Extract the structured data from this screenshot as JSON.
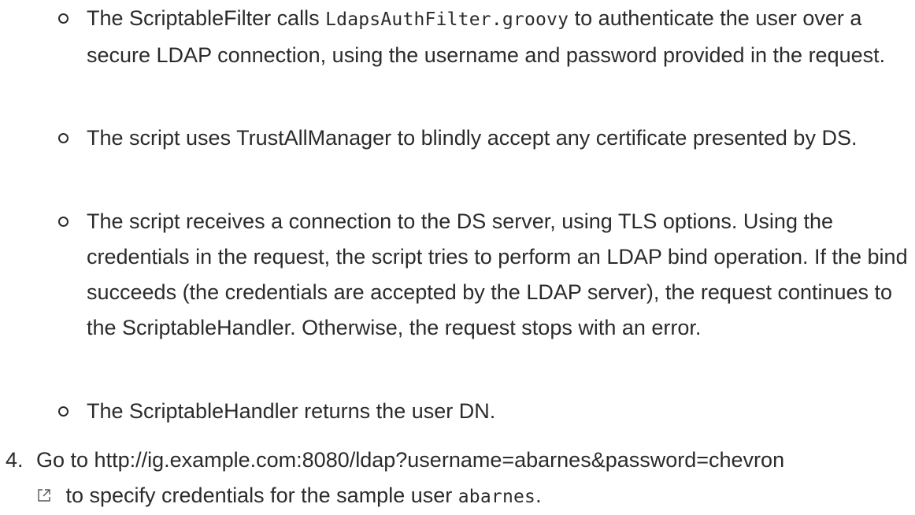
{
  "bullets": [
    {
      "pre": "The ScriptableFilter calls ",
      "code": "LdapsAuthFilter.groovy",
      "post": " to authenticate the user over a secure LDAP connection, using the username and password provided in the request."
    },
    {
      "text": "The script uses TrustAllManager to blindly accept any certificate presented by DS."
    },
    {
      "text": "The script receives a connection to the DS server, using TLS options. Using the credentials in the request, the script tries to perform an LDAP bind operation. If the bind succeeds (the credentials are accepted by the LDAP server), the request continues to the ScriptableHandler. Otherwise, the request stops with an error."
    },
    {
      "text": "The ScriptableHandler returns the user DN."
    }
  ],
  "step4": {
    "number": "4.",
    "pre": "Go to ",
    "link": "http://ig.example.com:8080/ldap?username=abarnes&password=chevron",
    "icon": "external-link-icon",
    "mid": " to specify credentials for the sample user ",
    "code": "abarnes",
    "post": "."
  }
}
